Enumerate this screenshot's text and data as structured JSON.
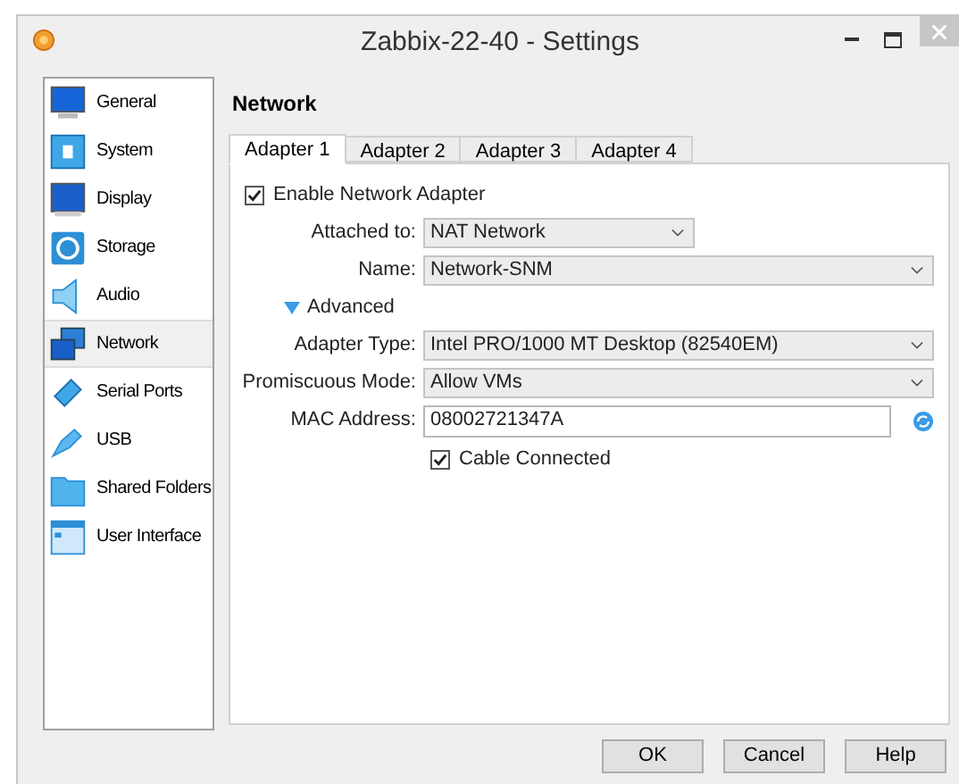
{
  "window": {
    "title": "Zabbix-22-40 - Settings"
  },
  "sidebar": {
    "items": [
      {
        "label": "General",
        "selected": false
      },
      {
        "label": "System",
        "selected": false
      },
      {
        "label": "Display",
        "selected": false
      },
      {
        "label": "Storage",
        "selected": false
      },
      {
        "label": "Audio",
        "selected": false
      },
      {
        "label": "Network",
        "selected": true
      },
      {
        "label": "Serial Ports",
        "selected": false
      },
      {
        "label": "USB",
        "selected": false
      },
      {
        "label": "Shared Folders",
        "selected": false
      },
      {
        "label": "User Interface",
        "selected": false
      }
    ]
  },
  "page": {
    "heading": "Network",
    "tabs": [
      {
        "label": "Adapter 1",
        "selected": true
      },
      {
        "label": "Adapter 2",
        "selected": false
      },
      {
        "label": "Adapter 3",
        "selected": false
      },
      {
        "label": "Adapter 4",
        "selected": false
      }
    ],
    "enable": {
      "label": "Enable Network Adapter",
      "checked": true
    },
    "attached_to": {
      "label": "Attached to:",
      "value": "NAT Network"
    },
    "name": {
      "label": "Name:",
      "value": "Network-SNM"
    },
    "advanced": {
      "label": "Advanced",
      "expanded": true
    },
    "adapter_type": {
      "label": "Adapter Type:",
      "value": "Intel PRO/1000 MT Desktop (82540EM)"
    },
    "promiscuous": {
      "label": "Promiscuous Mode:",
      "value": "Allow VMs"
    },
    "mac": {
      "label": "MAC Address:",
      "value": "08002721347A"
    },
    "cable": {
      "label": "Cable Connected",
      "checked": true
    }
  },
  "buttons": [
    "OK",
    "Cancel",
    "Help"
  ]
}
